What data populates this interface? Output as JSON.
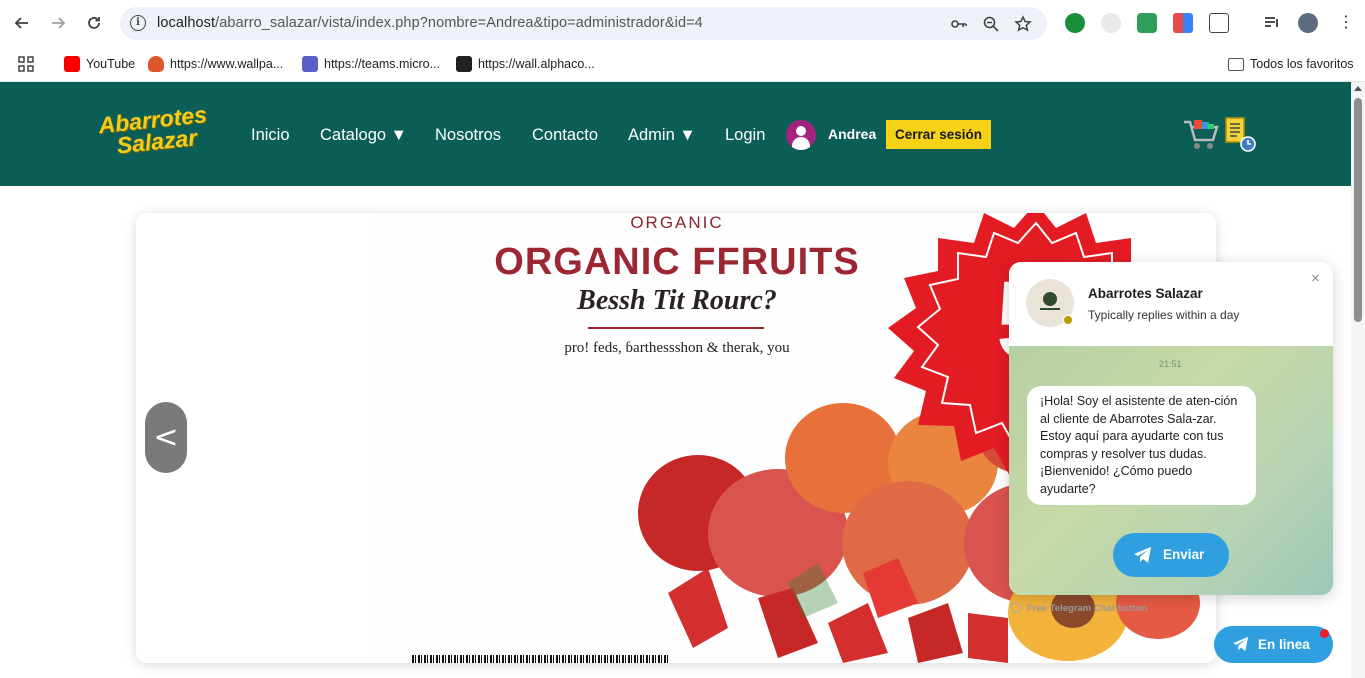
{
  "browser": {
    "url_host": "localhost",
    "url_path": "/abarro_salazar/vista/index.php?nombre=Andrea&tipo=administrador&id=4",
    "back_icon": "back-arrow-icon",
    "forward_icon": "forward-arrow-icon",
    "reload_icon": "reload-icon"
  },
  "bookmarks": {
    "items": [
      {
        "label": "YouTube",
        "color": "#ff0000"
      },
      {
        "label": "https://www.wallpa...",
        "color": "#e0562b"
      },
      {
        "label": "https://teams.micro...",
        "color": "#5b5fc7"
      },
      {
        "label": "https://wall.alphaco...",
        "color": "#222222"
      }
    ],
    "all_label": "Todos los favoritos"
  },
  "header": {
    "logo_line1": "Abarrotes",
    "logo_line2": "Salazar",
    "nav": [
      {
        "label": "Inicio"
      },
      {
        "label": "Catalogo ▼"
      },
      {
        "label": "Nosotros"
      },
      {
        "label": "Contacto"
      },
      {
        "label": "Admin ▼"
      },
      {
        "label": "Login"
      }
    ],
    "user_name": "Andrea",
    "logout_label": "Cerrar sesión",
    "brand_color": "#0a5e55",
    "accent_color": "#f5d215"
  },
  "banner": {
    "line1": "ORGANIC",
    "line2": "ORGANIC FFRUITS",
    "line3": "Bessh Tit Rourc?",
    "line4": "pro! feds, ɓarthessshon & therak, you",
    "burst_text": "5",
    "prev_label": "<"
  },
  "chat": {
    "title": "Abarrotes Salazar",
    "subtitle": "Typically replies within a day",
    "close_label": "×",
    "time": "21:51",
    "message": "¡Hola! Soy el asistente de aten-ción al cliente de Abarrotes Sala-zar. Estoy aquí para ayudarte con tus compras y resolver tus dudas. ¡Bienvenido! ¿Cómo puedo ayudarte?",
    "send_label": "Enviar",
    "credit": "Free Telegram Chat button",
    "online_label": "En linea"
  }
}
